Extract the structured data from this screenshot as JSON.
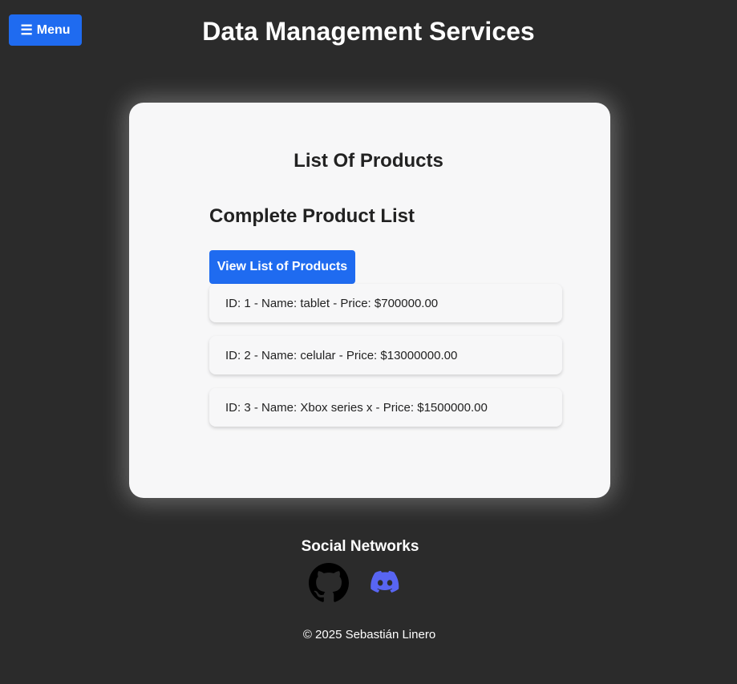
{
  "header": {
    "menu_icon": "☰",
    "menu_label": "Menu",
    "title": "Data Management Services"
  },
  "card": {
    "title": "List Of Products",
    "section_title": "Complete Product List",
    "view_button_label": "View List of Products",
    "products": [
      "ID: 1 - Name: tablet - Price: $700000.00",
      "ID: 2 - Name: celular - Price: $13000000.00",
      "ID: 3 - Name: Xbox series x - Price: $1500000.00"
    ]
  },
  "footer": {
    "social_title": "Social Networks",
    "social_icons": [
      "github-icon",
      "discord-icon"
    ],
    "copyright": "© 2025 Sebastián Linero"
  },
  "colors": {
    "background": "#2b2b2b",
    "accent": "#1f6bf0",
    "card": "#f7f7f8",
    "discord": "#5865f2"
  }
}
